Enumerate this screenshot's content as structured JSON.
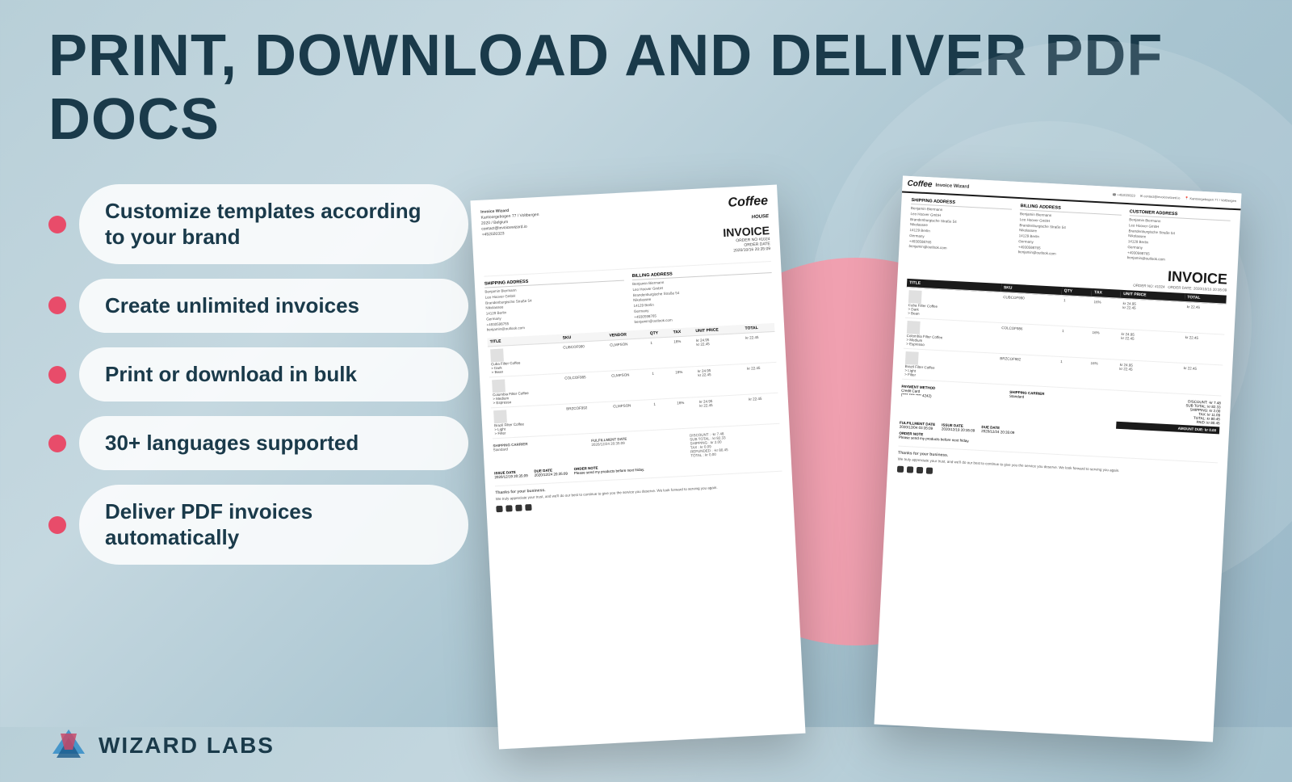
{
  "header": {
    "title": "PRINT, DOWNLOAD AND DELIVER PDF DOCS"
  },
  "features": [
    {
      "id": "customize",
      "bullet_color": "#e84c6a",
      "text": "Customize templates according to your brand"
    },
    {
      "id": "unlimited",
      "bullet_color": "#e84c6a",
      "text": "Create unlimited invoices"
    },
    {
      "id": "bulk",
      "bullet_color": "#e84c6a",
      "text": "Print or download in bulk"
    },
    {
      "id": "languages",
      "bullet_color": "#e84c6a",
      "text": "30+ languages supported"
    },
    {
      "id": "deliver",
      "bullet_color": "#e84c6a",
      "text": "Deliver PDF invoices automatically"
    }
  ],
  "logo": {
    "text": "WIZARD LABS"
  },
  "invoice_left": {
    "company": "Invoice Wizard",
    "address": "Kantoorgebogen 77 / Voltbergen\n2020 / Belgium\ncontact@invoicewizard.io\n+452020323",
    "shipping_label": "SHIPPING ADDRESS",
    "billing_label": "BILLING ADDRESS",
    "shipping": "Benjamin Biermann\nLeo Hoover GmbH\nBrandenburgische Straße 54\nNikolassee\n14129 Berlin\nGermany\n+4930598765\nbenjamin@outlook.com",
    "billing": "Benjamin Biermann\nLeo Hoover GmbH\nBrandenburgische Straße 54\nNikolassee\n14129 Berlin\nGermany\n+4930598765\nbenjamin@outlook.com",
    "invoice_label": "INVOICE",
    "order_no": "ORDER NO #1024",
    "order_date": "ORDER DATE\n2020/10/16 20:35:09",
    "items": [
      {
        "name": "Cuba Filter Coffee",
        "variants": "> Dark\n> Bean",
        "sku": "CUBCOF990",
        "vendor": "CLMPSON",
        "qty": "1",
        "tax": "16%",
        "unit_price": "kr 24.95\nkr 22.45",
        "total": "kr 22.45"
      },
      {
        "name": "Colombia Filter Coffee",
        "variants": "> Medium\n> Espresso",
        "sku": "COLCOF985",
        "vendor": "CLMPSON",
        "qty": "1",
        "tax": "16%",
        "unit_price": "kr 24.95\nkr 22.45",
        "total": "kr 22.45"
      },
      {
        "name": "Brazil Filter Coffee",
        "variants": "> Light\n> Filter",
        "sku": "BRZCOF992",
        "vendor": "CLMPSON",
        "qty": "1",
        "tax": "16%",
        "unit_price": "kr 24.95\nkr 22.45",
        "total": "kr 22.45"
      }
    ],
    "shipping_carrier": "SHIPPING CARRIER\nStandard",
    "fulfillment_date": "FULFILLMENT DATE\n2020/12/24 20:35:09",
    "discount": "DISCOUNT : -kr 7.48",
    "sub_total": "SUB TOTAL : kr 82.33",
    "shipping_cost": "SHIPPING : kr 2.00",
    "tax_amount": "TAX : kr 0.09",
    "refunded": "REFUNDED : -kr 80.45",
    "total": "TOTAL : kr 0.00",
    "issue_date": "ISSUE DATE\n2020/12/19 20:35:09",
    "due_date": "DUE DATE\n2020/12/24 20:35:09",
    "order_note": "ORDER NOTE\nPlease send my products before next friday.",
    "thanks": "Thanks for your business.",
    "thanks_body": "We truly appreciate your trust, and we'll do our best to continue to give you the service you deserve. We look forward to serving you again."
  },
  "invoice_right": {
    "company": "Invoice Wizard",
    "logo_text": "Coffee",
    "invoice_label": "INVOICE",
    "order_no": "ORDER NO: #1024",
    "order_date": "ORDER DATE: 2020/10/16 20:35:09",
    "shipping_label": "SHIPPING ADDRESS",
    "billing_label": "BILLING ADDRESS",
    "customer_label": "CUSTOMER ADDRESS",
    "shipping": "Benjamin Biermann\nLeo Hoover GmbH\nBrandenburgische Straße 54\nNikolassee\n14129 Berlin\nGermany\n+4930598765\nbenjamin@outlook.com",
    "billing": "Benjamin Biermann\nLeo Hoover GmbH\nBrandenburgische Straße 54\nNikolassee\n14129 Berlin\nGermany\n+4930598765\nbenjamin@outlook.com",
    "items": [
      {
        "name": "Cuba Filter Coffee",
        "variants": "> Dark\n> Bean",
        "sku": "CUBCOF990",
        "qty": "1",
        "tax": "16%",
        "unit_price": "kr 24.95\nkr 22.45",
        "total": "kr 22.45"
      },
      {
        "name": "Colombia Filter Coffee",
        "variants": "> Medium\n> Espresso",
        "sku": "COLCOF986",
        "qty": "1",
        "tax": "16%",
        "unit_price": "kr 24.95\nkr 22.45",
        "total": "kr 22.45"
      },
      {
        "name": "Brazil Filter Coffee",
        "variants": "> Light\n> Filter",
        "sku": "BRZCOF982",
        "qty": "1",
        "tax": "16%",
        "unit_price": "kr 24.95\nkr 22.45",
        "total": "kr 22.45"
      }
    ],
    "payment_method": "PAYMENT METHOD\nCredit Card\n(**** **** **** 4242)",
    "shipping_carrier": "SHIPPING CARRIER\nStandard",
    "fulfillment_date": "FULFILLMENT DATE\n2020/12/04 03:35:09",
    "issue_date": "ISSUE DATE\n2020/12/19 20:35:09",
    "due_date": "DUE DATE\n2020/12/24 20:35:09",
    "order_note": "ORDER NOTE\nPlease send my products before next friday.",
    "discount": "DISCOUNT: -kr 7.48",
    "sub_total": "SUB TOTAL: kr 82.33",
    "shipping_cost": "SHIPPING: kr 2.00",
    "tax_amount": "TAX: kr 11.09",
    "total": "TOTAL: kr 80.45",
    "paid": "PAID: kr 80.45",
    "amount_due": "AMOUNT DUE: kr 0.00",
    "thanks": "Thanks for your business.",
    "thanks_body": "We truly appreciate your trust, and we'll do our best to continue to give you the service you deserve. We look forward to serving you again."
  }
}
